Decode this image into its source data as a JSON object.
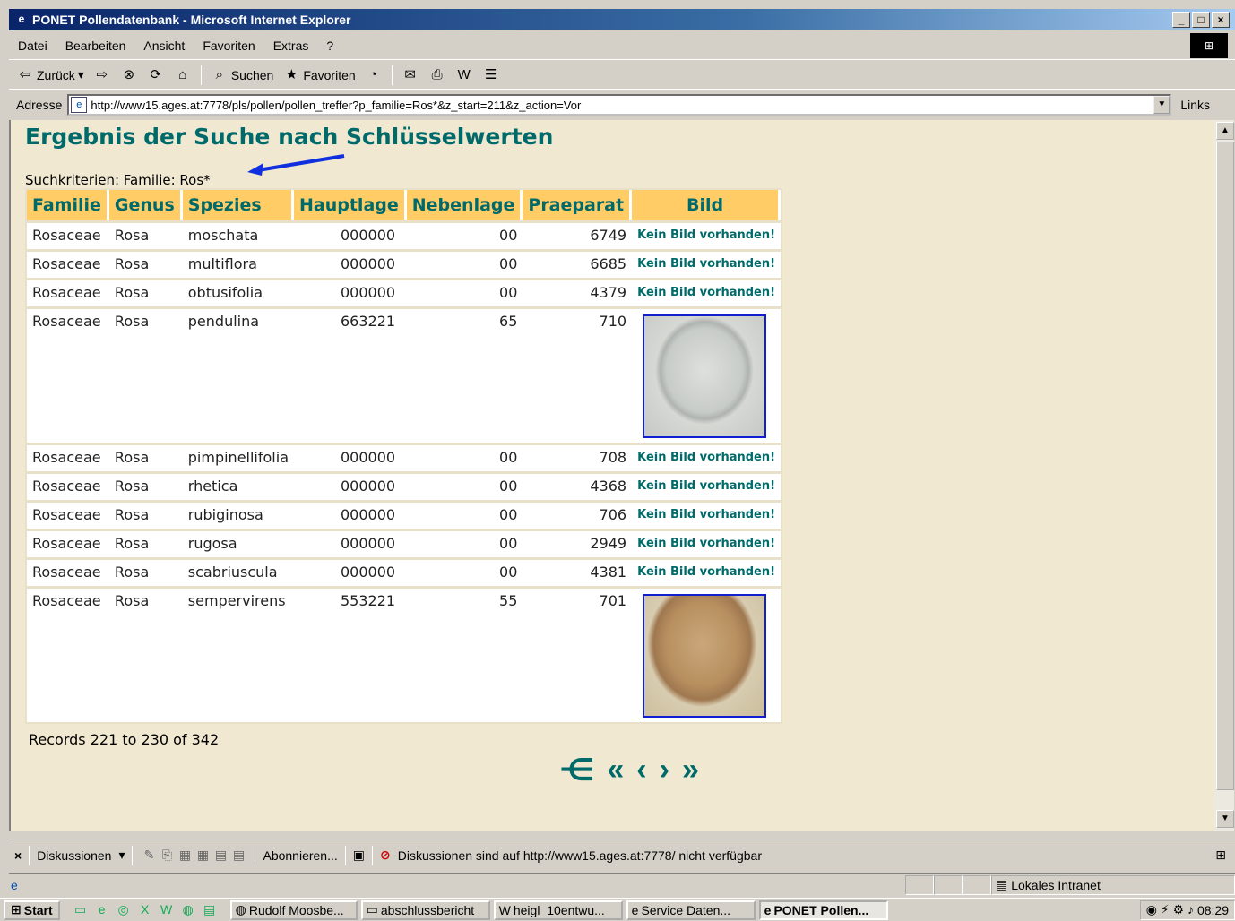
{
  "window": {
    "title": "PONET Pollendatenbank - Microsoft Internet Explorer",
    "controls": [
      "_",
      "□",
      "×"
    ]
  },
  "menu": [
    "Datei",
    "Bearbeiten",
    "Ansicht",
    "Favoriten",
    "Extras",
    "?"
  ],
  "toolbar": {
    "back": "Zurück",
    "search": "Suchen",
    "favorites": "Favoriten"
  },
  "address": {
    "label": "Adresse",
    "url": "http://www15.ages.at:7778/pls/pollen/pollen_treffer?p_familie=Ros*&z_start=211&z_action=Vor",
    "links": "Links"
  },
  "page": {
    "heading": "Ergebnis der Suche nach Schlüsselwerten",
    "criteria": "Suchkriterien: Familie: Ros*",
    "columns": [
      "Familie",
      "Genus",
      "Spezies",
      "Hauptlage",
      "Nebenlage",
      "Praeparat",
      "Bild"
    ],
    "no_image": "Kein Bild vorhanden!",
    "rows": [
      {
        "familie": "Rosaceae",
        "genus": "Rosa",
        "spezies": "moschata",
        "hauptlage": "000000",
        "nebenlage": "00",
        "praeparat": "6749",
        "bild": "none"
      },
      {
        "familie": "Rosaceae",
        "genus": "Rosa",
        "spezies": "multiflora",
        "hauptlage": "000000",
        "nebenlage": "00",
        "praeparat": "6685",
        "bild": "none"
      },
      {
        "familie": "Rosaceae",
        "genus": "Rosa",
        "spezies": "obtusifolia",
        "hauptlage": "000000",
        "nebenlage": "00",
        "praeparat": "4379",
        "bild": "none"
      },
      {
        "familie": "Rosaceae",
        "genus": "Rosa",
        "spezies": "pendulina",
        "hauptlage": "663221",
        "nebenlage": "65",
        "praeparat": "710",
        "bild": "p1"
      },
      {
        "familie": "Rosaceae",
        "genus": "Rosa",
        "spezies": "pimpinellifolia",
        "hauptlage": "000000",
        "nebenlage": "00",
        "praeparat": "708",
        "bild": "none"
      },
      {
        "familie": "Rosaceae",
        "genus": "Rosa",
        "spezies": "rhetica",
        "hauptlage": "000000",
        "nebenlage": "00",
        "praeparat": "4368",
        "bild": "none"
      },
      {
        "familie": "Rosaceae",
        "genus": "Rosa",
        "spezies": "rubiginosa",
        "hauptlage": "000000",
        "nebenlage": "00",
        "praeparat": "706",
        "bild": "none"
      },
      {
        "familie": "Rosaceae",
        "genus": "Rosa",
        "spezies": "rugosa",
        "hauptlage": "000000",
        "nebenlage": "00",
        "praeparat": "2949",
        "bild": "none"
      },
      {
        "familie": "Rosaceae",
        "genus": "Rosa",
        "spezies": "scabriuscula",
        "hauptlage": "000000",
        "nebenlage": "00",
        "praeparat": "4381",
        "bild": "none"
      },
      {
        "familie": "Rosaceae",
        "genus": "Rosa",
        "spezies": "sempervirens",
        "hauptlage": "553221",
        "nebenlage": "55",
        "praeparat": "701",
        "bild": "p2"
      }
    ],
    "records": "Records 221 to 230 of 342",
    "pager": [
      "⋲",
      "«",
      "‹",
      "›",
      "»"
    ]
  },
  "discussion": {
    "label": "Diskussionen",
    "subscribe": "Abonnieren...",
    "message": "Diskussionen sind auf http://www15.ages.at:7778/ nicht verfügbar"
  },
  "status": {
    "zone": "Lokales Intranet"
  },
  "taskbar": {
    "start": "Start",
    "buttons": [
      "Rudolf Moosbe...",
      "abschlussbericht",
      "heigl_10entwu...",
      "Service Daten...",
      "PONET Pollen..."
    ],
    "active": 4,
    "clock": "08:29"
  },
  "colors": {
    "accent": "#006a6a",
    "header_bg": "#ffcc66",
    "page_bg": "#f0e8d0"
  }
}
